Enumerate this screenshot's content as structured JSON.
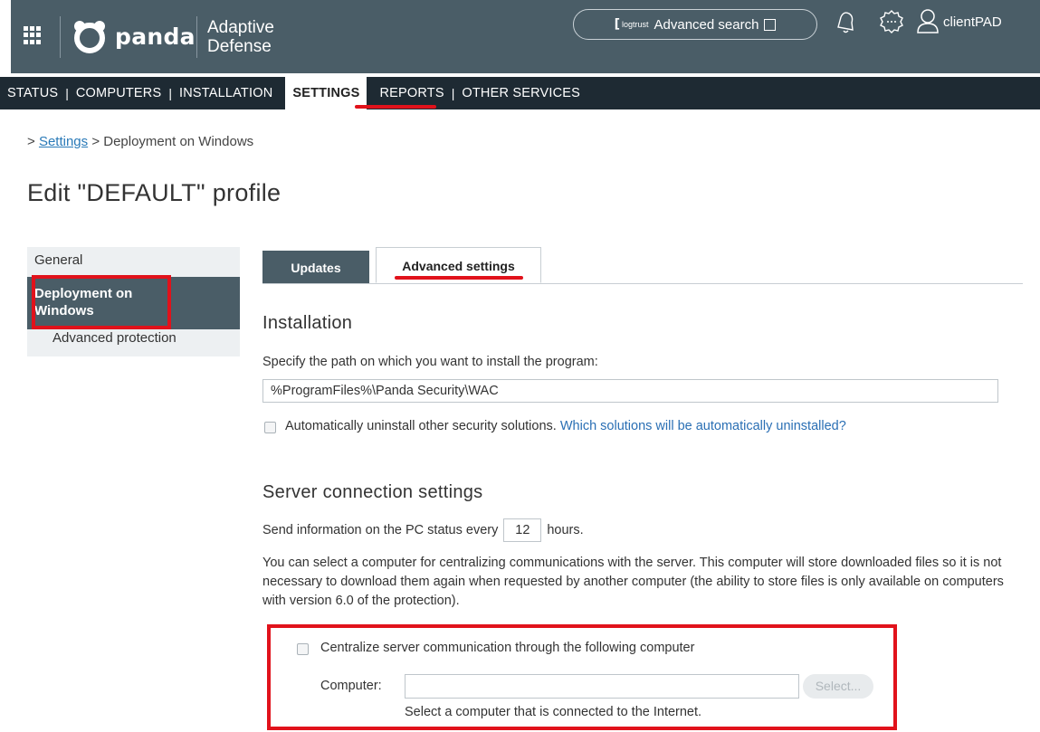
{
  "header": {
    "logo_text": "panda",
    "product_line1": "Adaptive",
    "product_line2": "Defense",
    "search_brand": "logtrust",
    "search_label": "Advanced search",
    "username": "clientPAD"
  },
  "nav": {
    "items": [
      "STATUS",
      "COMPUTERS",
      "INSTALLATION",
      "SETTINGS",
      "REPORTS",
      "OTHER SERVICES"
    ],
    "separator": "|",
    "active": "SETTINGS"
  },
  "breadcrumb": {
    "prefix": ">",
    "link": "Settings",
    "current": "> Deployment on Windows"
  },
  "page_title": "Edit \"DEFAULT\" profile",
  "sidebar": {
    "items": [
      {
        "label": "General"
      },
      {
        "label_line1": "Deployment on",
        "label_line2": "Windows"
      },
      {
        "label": "Advanced protection"
      }
    ]
  },
  "tabs": {
    "updates": "Updates",
    "advanced": "Advanced settings"
  },
  "installation": {
    "heading": "Installation",
    "path_label": "Specify the path on which you want to install the program:",
    "path_value": "%ProgramFiles%\\Panda Security\\WAC",
    "uninstall_label": "Automatically uninstall other security solutions.",
    "uninstall_link": "Which solutions will be automatically uninstalled?"
  },
  "server": {
    "heading": "Server connection settings",
    "send_prefix": "Send information on the PC status every",
    "send_value": "12",
    "send_suffix": "hours.",
    "description": "You can select a computer for centralizing communications with the server. This computer will store downloaded files so it is not necessary to download them again when requested by another computer (the ability to store files is only available on computers with version 6.0 of the protection).",
    "centralize_label": "Centralize server communication through the following computer",
    "computer_label": "Computer:",
    "computer_value": "",
    "select_button": "Select...",
    "hint": "Select a computer that is connected to the Internet."
  },
  "colors": {
    "header_bg": "#4a5d67",
    "nav_bg": "#1e2a33",
    "highlight_red": "#e1121b",
    "link_blue": "#2a6fb4"
  }
}
